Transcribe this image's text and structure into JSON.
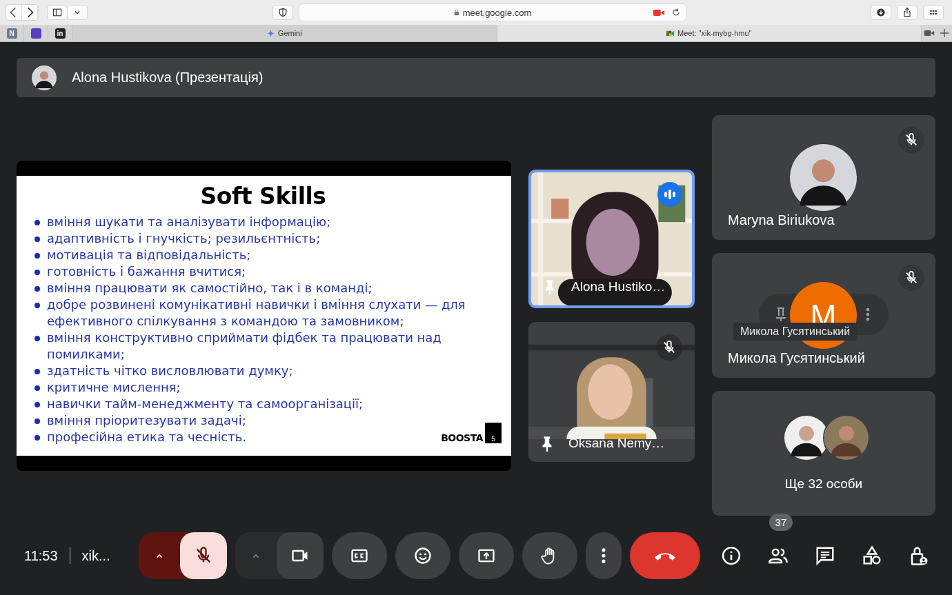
{
  "browser": {
    "address": "meet.google.com",
    "pinned_tabs": [
      {
        "label": "N",
        "color": "#6b7a8f"
      },
      {
        "color": "#5b3cc4"
      },
      {
        "label": "in",
        "color": "#222222"
      }
    ],
    "tabs": [
      {
        "title": "Gemini",
        "selected": false
      },
      {
        "title": "Meet: \"xik-mybg-hmu\"",
        "selected": true
      }
    ]
  },
  "presenter_bar": {
    "name": "Alona Hustikova (Презентація)"
  },
  "slide": {
    "title": "Soft Skills",
    "bullets": [
      "вміння шукати та аналізувати інформацію;",
      "адаптивність і гнучкість; резильєнтність;",
      "мотивація та відповідальність;",
      "готовність і бажання вчитися;",
      "вміння працювати як самостійно, так і в команді;",
      "добре розвинені комунікативні навички і вміння слухати — для ефективного спілкування з командою та замовником;",
      "вміння конструктивно сприймати фідбек та працювати над помилками;",
      "здатність чітко висловлювати думку;",
      "критичне мислення;",
      "навички тайм-менеджменту та самоорганізації;",
      "вміння пріоритезувати задачі;",
      "професійна етика та чесність."
    ],
    "logo": "BOOSTA",
    "page": "5"
  },
  "tiles": [
    {
      "kind": "video",
      "name": "Alona Hustiko…",
      "speaking": true,
      "muted": false
    },
    {
      "kind": "video",
      "name": "Oksana Nemy…",
      "speaking": false,
      "muted": true
    },
    {
      "kind": "avatar",
      "name": "Maryna Biriukova",
      "muted": true,
      "hovered": false
    },
    {
      "kind": "avatar",
      "name": "Микола Гусятинський",
      "muted": true,
      "hovered": true,
      "initial": "M",
      "tooltip": "Микола Гусятинський"
    },
    {
      "kind": "more",
      "label": "Ще 32 особи"
    }
  ],
  "controls": {
    "time": "11:53",
    "meeting": "xik...",
    "mic_muted": true,
    "people_count": "37"
  }
}
